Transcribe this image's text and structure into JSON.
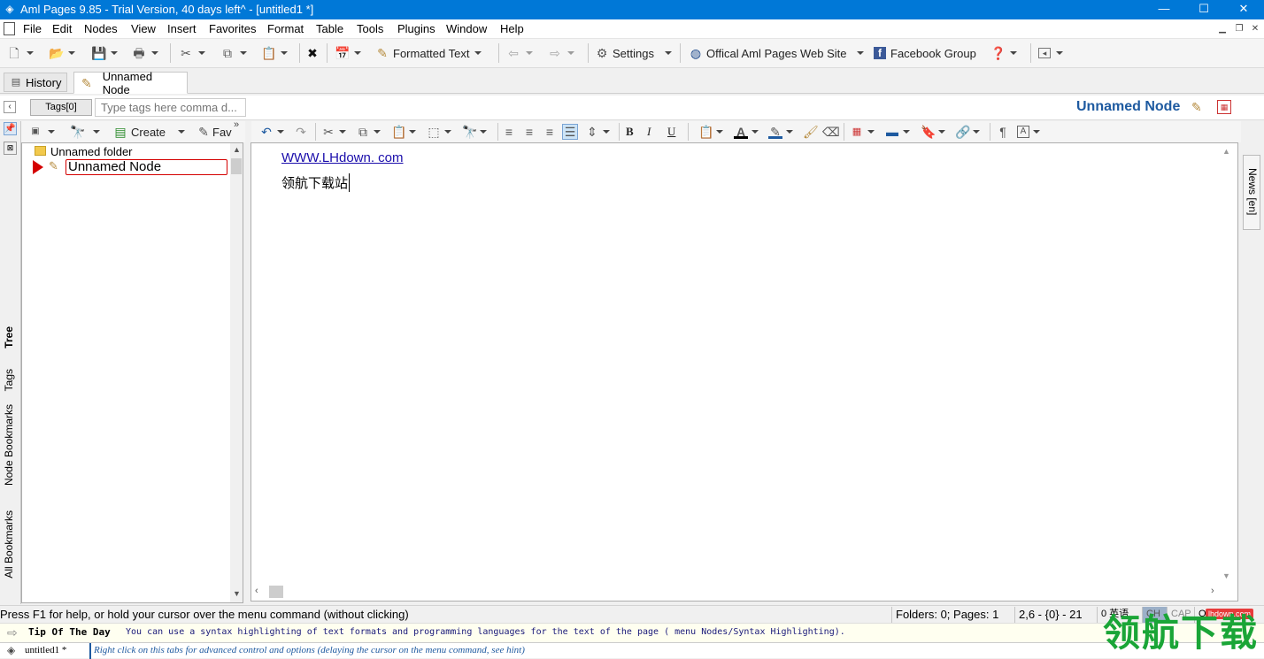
{
  "window": {
    "title": "Aml Pages 9.85 - Trial Version, 40 days left^ - [untitled1 *]",
    "minimize": "—",
    "maximize": "☐",
    "close": "✕"
  },
  "menu": [
    "File",
    "Edit",
    "Nodes",
    "View",
    "Insert",
    "Favorites",
    "Format",
    "Table",
    "Tools",
    "Plugins",
    "Window",
    "Help"
  ],
  "toolbar": {
    "formatted_text": "Formatted Text",
    "settings": "Settings",
    "website": "Offical Aml Pages Web Site",
    "facebook": "Facebook Group"
  },
  "tabs": {
    "history": "History",
    "active": "Unnamed Node"
  },
  "tags": {
    "button": "Tags[0]",
    "placeholder": "Type tags here comma d...",
    "node_title": "Unnamed Node"
  },
  "left_toolbar": {
    "create": "Create",
    "fav": "Fav"
  },
  "tree": {
    "folder": "Unnamed folder",
    "node": "Unnamed Node"
  },
  "vertical_tabs": {
    "tree": "Tree",
    "tags": "Tags",
    "node_bookmarks": "Node Bookmarks",
    "all_bookmarks": "All Bookmarks",
    "news": "News [en]"
  },
  "editor": {
    "link": "WWW.LHdown. com",
    "line2": "领航下载站"
  },
  "status": {
    "help": "Press F1 for help, or hold your cursor over the menu command (without clicking)",
    "counts": "Folders: 0; Pages: 1",
    "position": "2,6 - {0} - 21",
    "ime": "0 英语",
    "ch": "CH",
    "cap": "CAP",
    "o": "O"
  },
  "tip": {
    "label": "Tip Of The Day",
    "text": "You can use a syntax highlighting of text formats and programming languages for the text of the page ( menu Nodes/Syntax Highlighting)."
  },
  "bottom": {
    "doc_tab": "untitled1 *",
    "hint": "Right click on this tabs for advanced control and options (delaying the cursor on the menu command, see hint)"
  },
  "watermark": {
    "big": "领航下载",
    "small": "lhdown.com"
  },
  "colors": {
    "titlebar": "#0078d7",
    "link": "#1a0dab",
    "accent": "#1e5aa0",
    "marker": "#d40000",
    "watermark": "#1aa537"
  }
}
